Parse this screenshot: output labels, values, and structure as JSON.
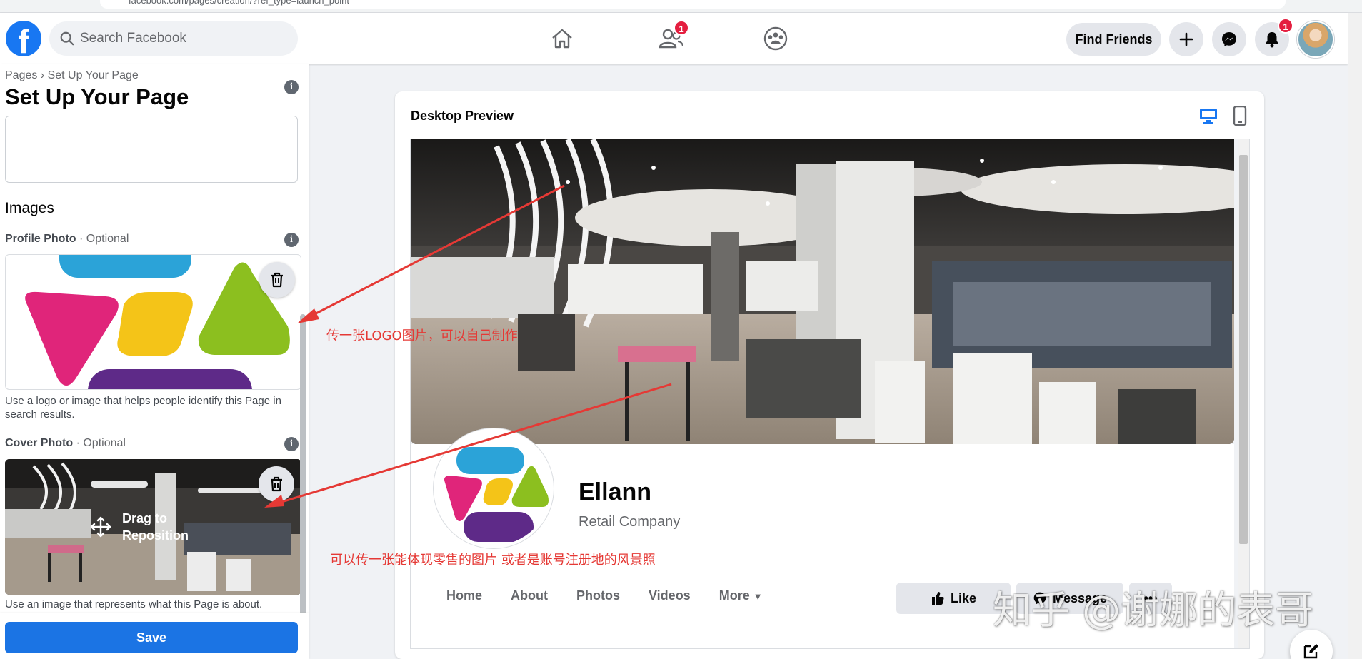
{
  "browser": {
    "url": "facebook.com/pages/creation/?ref_type=launch_point"
  },
  "topnav": {
    "search_placeholder": "Search Facebook",
    "friends_badge": "1",
    "notifications_badge": "1",
    "find_friends_label": "Find Friends"
  },
  "sidebar": {
    "breadcrumb": "Pages › Set Up Your Page",
    "title": "Set Up Your Page",
    "images_heading": "Images",
    "profile_label": "Profile Photo",
    "profile_optional": " · Optional",
    "profile_help": "Use a logo or image that helps people identify this Page in search results.",
    "cover_label": "Cover Photo",
    "cover_optional": " · Optional",
    "cover_drag_hint": "Drag to Reposition",
    "cover_help": "Use an image that represents what this Page is about.",
    "save_label": "Save"
  },
  "preview": {
    "title": "Desktop Preview",
    "page_name": "Ellann",
    "page_category": "Retail Company",
    "tabs": [
      "Home",
      "About",
      "Photos",
      "Videos",
      "More"
    ],
    "like_label": "Like",
    "message_label": "Message"
  },
  "annotations": {
    "logo_note": "传一张LOGO图片，可以自己制作",
    "cover_note": "可以传一张能体现零售的图片 或者是账号注册地的风景照",
    "watermark": "知乎 @谢娜的表哥"
  },
  "colors": {
    "brand_blue": "#1877f2",
    "save_blue": "#1b74e4",
    "badge_red": "#e41e3f",
    "annotation_red": "#e53935"
  }
}
